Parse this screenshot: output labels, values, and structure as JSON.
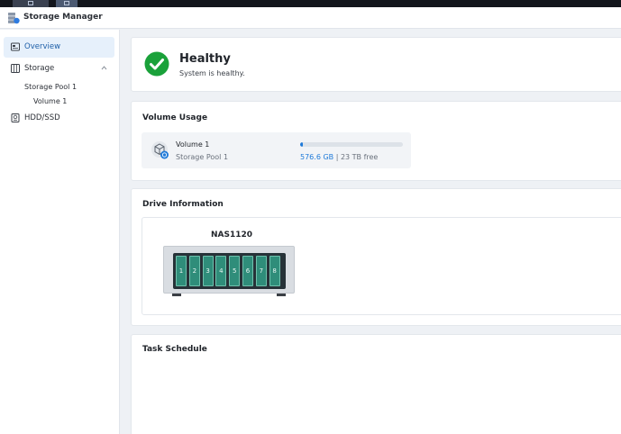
{
  "app": {
    "title": "Storage Manager"
  },
  "sidebar": {
    "items": [
      {
        "label": "Overview",
        "icon": "overview-icon"
      },
      {
        "label": "Storage",
        "icon": "storage-icon"
      },
      {
        "label": "HDD/SSD",
        "icon": "hdd-icon"
      }
    ],
    "sub_items": [
      {
        "label": "Storage Pool 1"
      },
      {
        "label": "Volume 1"
      }
    ]
  },
  "health": {
    "title": "Healthy",
    "subtitle": "System is healthy."
  },
  "volume_usage": {
    "title": "Volume Usage",
    "volume_name": "Volume 1",
    "pool_name": "Storage Pool 1",
    "used": "576.6 GB",
    "separator": "|",
    "free": "23 TB free",
    "used_fraction": 0.024
  },
  "drive_info": {
    "title": "Drive Information",
    "nas_name": "NAS1120",
    "bays": [
      "1",
      "2",
      "3",
      "4",
      "5",
      "6",
      "7",
      "8"
    ]
  },
  "task_schedule": {
    "title": "Task Schedule"
  },
  "colors": {
    "accent": "#1f7ad9",
    "healthy": "#1aa13a",
    "bay": "#2f8d7a"
  }
}
